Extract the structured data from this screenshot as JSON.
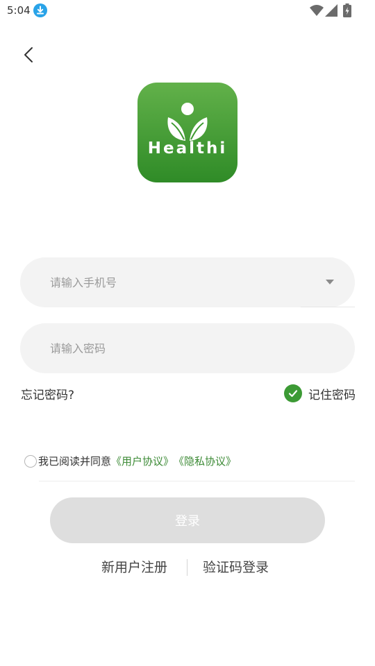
{
  "status_bar": {
    "time": "5:04",
    "icons": [
      "download-icon",
      "wifi-icon",
      "signal-icon",
      "battery-icon"
    ]
  },
  "back": {
    "icon": "chevron-left-icon"
  },
  "logo": {
    "text": "Healthi",
    "icon": "person-leaves-icon",
    "colors": {
      "top": "#62b14a",
      "bottom": "#2f8b27"
    }
  },
  "phone_field": {
    "placeholder": "请输入手机号",
    "value": "",
    "dropdown_icon": "caret-down-icon"
  },
  "password_field": {
    "placeholder": "请输入密码",
    "value": ""
  },
  "forgot_password": "忘记密码?",
  "remember_password": {
    "label": "记住密码",
    "checked": true
  },
  "agreement": {
    "checked": false,
    "text": "我已阅读并同意",
    "user_agreement": "《用户协议》",
    "privacy_policy": "《隐私协议》"
  },
  "login_button": "登录",
  "bottom_links": {
    "register": "新用户注册",
    "sms_login": "验证码登录"
  },
  "colors": {
    "accent": "#3c9a35",
    "link": "#3c8a35",
    "button_disabled": "#dedede",
    "input_bg": "#f3f3f3"
  }
}
